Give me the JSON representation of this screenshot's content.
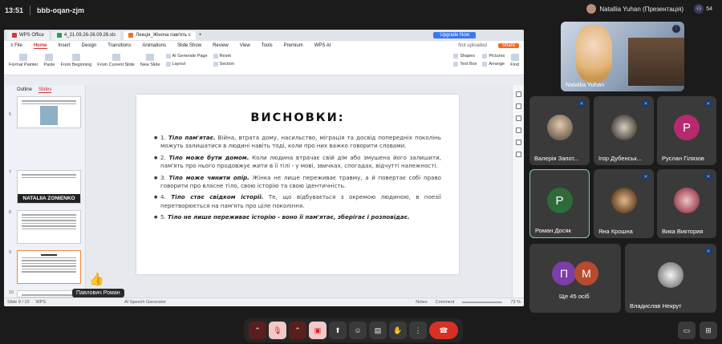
{
  "meeting": {
    "time": "13:51",
    "code": "bbb-oqan-zjm",
    "presenter_label": "Natallia Yuhan (Презентація)",
    "participant_count": "54"
  },
  "wps": {
    "tabs": [
      "WPS Office",
      "4_21.09.26-26.09.26.xls",
      "Лекція_Жіноча пам'ять с"
    ],
    "upgrade": "Upgrade Now",
    "menu": [
      "≡ File",
      "Home",
      "Insert",
      "Design",
      "Transitions",
      "Animations",
      "Slide Show",
      "Review",
      "View",
      "Tools",
      "Premium",
      "WPS AI"
    ],
    "not_uploaded": "Not uploaded",
    "share": "Share",
    "ribbon": {
      "format_painter": "Format Painter",
      "paste": "Paste",
      "from_beginning": "From Beginning",
      "from_current": "From Current Slide",
      "new_slide": "New Slide",
      "ai_page": "AI Generate Page",
      "layout": "Layout",
      "reset": "Reset",
      "section": "Section",
      "shapes": "Shapes",
      "pictures": "Pictures",
      "text_box": "Text Box",
      "arrange": "Arrange",
      "find": "Find"
    },
    "pane_tabs": [
      "Outline",
      "Slides"
    ],
    "thumbs": [
      "5",
      "7",
      "8",
      "9",
      "10"
    ],
    "name_overlay": "NATALIIA ZONIENKO",
    "status": {
      "slide": "Slide 9 / 10",
      "app": "WPS",
      "notes": "Notes",
      "comment": "Comment",
      "zoom": "73 %",
      "speech": "AI Speech Generator"
    }
  },
  "slide": {
    "title": "ВИСНОВКИ:",
    "bullets": [
      {
        "n": "1.",
        "lead": "Тіло пам'ятає.",
        "text": " Війна, втрата дому, насильство, міграція та досвід попередніх поколінь можуть залишатися в людині навіть тоді, коли про них важко говорити словами."
      },
      {
        "n": "2.",
        "lead": "Тіло може бути домом.",
        "text": " Коли людина втрачає свій дім або змушена його залишити, пам'ять про нього продовжує жити в її тілі - у мові, звичках, спогадах, відчутті належності."
      },
      {
        "n": "3.",
        "lead": "Тіло може чинити опір.",
        "text": " Жінка не лише переживає травму, а й повертає собі право говорити про власне тіло, свою історію та свою ідентичність."
      },
      {
        "n": "4.",
        "lead": "Тіло стає свідком історії.",
        "text": " Те, що відбувається з окремою людиною, в поезії перетворюється на пам'ять про ціле покоління."
      },
      {
        "n": "5.",
        "lead": "Тіло не лише переживає історію - воно її пам'ятає, зберігає і розповідає.",
        "text": ""
      }
    ]
  },
  "reaction": {
    "emoji": "👍",
    "name": "Павлович Роман"
  },
  "participants": [
    {
      "name": "Natallia Yuhan"
    },
    {
      "name": "Валерія Запот...",
      "initial": ""
    },
    {
      "name": "Ігор Дубенськ...",
      "initial": ""
    },
    {
      "name": "Руслан Гілязов",
      "initial": "Р"
    },
    {
      "name": "Роман Досяк",
      "initial": "Р"
    },
    {
      "name": "Яна Крошна",
      "initial": ""
    },
    {
      "name": "Вика Виктория",
      "initial": ""
    },
    {
      "name": "Ще 45 осіб",
      "initials": [
        "П",
        "М"
      ]
    },
    {
      "name": "Владислав Некрут",
      "initial": ""
    }
  ],
  "colors": {
    "accent": "#3a78f2",
    "hangup": "#d93025",
    "purple": "#7b3fa7",
    "green": "#2e6b3a",
    "maroon": "#b84a2e"
  }
}
